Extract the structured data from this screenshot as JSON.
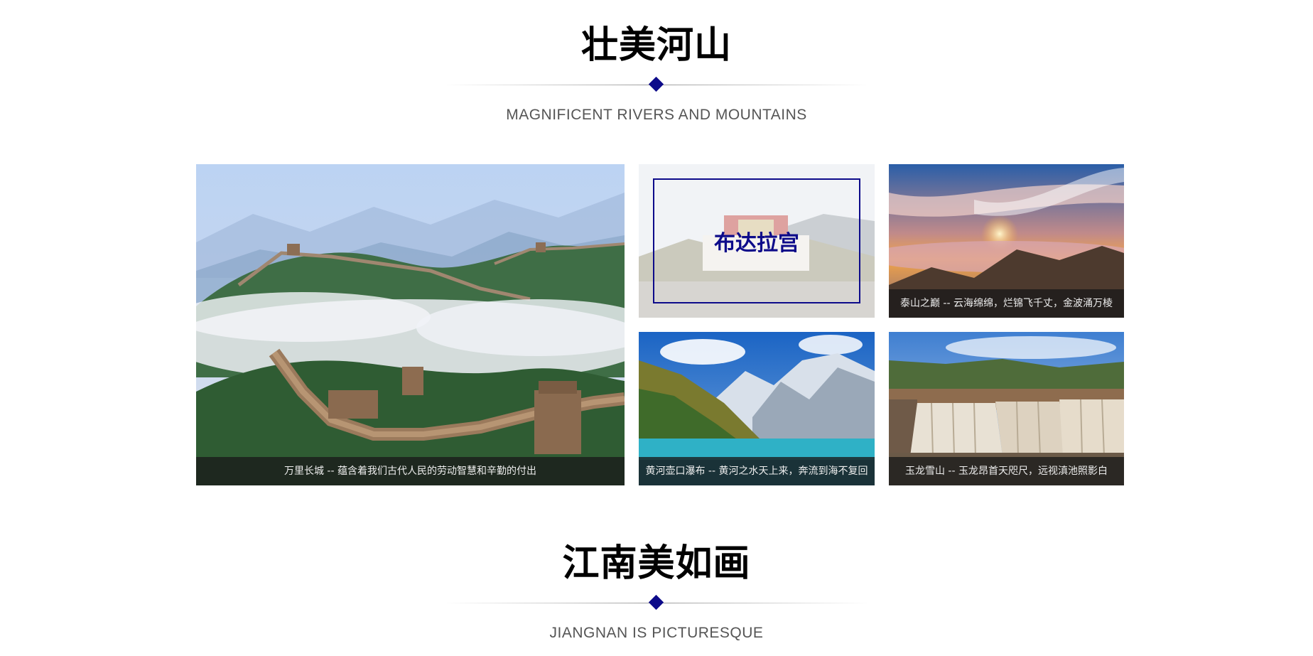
{
  "colors": {
    "accent": "#0d0b8a",
    "caption_bg": "#191919"
  },
  "section1": {
    "title": "壮美河山",
    "subtitle": "MAGNIFICENT RIVERS AND MOUNTAINS"
  },
  "gallery": {
    "great_wall": {
      "caption": "万里长城 -- 蕴含着我们古代人民的劳动智慧和辛勤的付出"
    },
    "potala": {
      "label": "布达拉宫"
    },
    "taishan": {
      "caption": "泰山之巅 -- 云海绵绵，烂锦飞千丈，金波涌万棱"
    },
    "yellow_river": {
      "caption": "黄河壶口瀑布 -- 黄河之水天上来，奔流到海不复回"
    },
    "yulong": {
      "caption": "玉龙雪山 -- 玉龙昂首天咫尺，远视滇池照影白"
    }
  },
  "section2": {
    "title": "江南美如画",
    "subtitle": "JIANGNAN IS PICTURESQUE"
  }
}
